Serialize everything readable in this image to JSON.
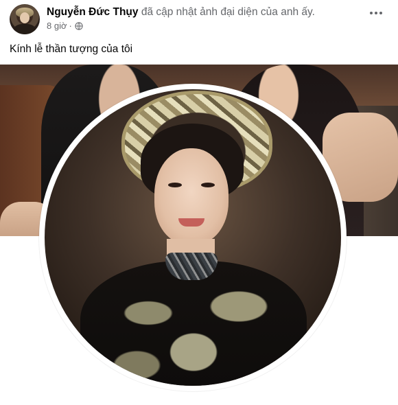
{
  "post": {
    "author": "Nguyễn Đức Thụy",
    "action_text": "đã cập nhật ảnh đại diện của anh ấy.",
    "time": "8 giờ",
    "separator": "·",
    "audience_icon": "globe-icon",
    "more_icon": "more-options-icon",
    "caption": "Kính lễ thần tượng của tôi"
  },
  "colors": {
    "primary_text": "#050505",
    "secondary_text": "#65676b",
    "background": "#ffffff"
  }
}
